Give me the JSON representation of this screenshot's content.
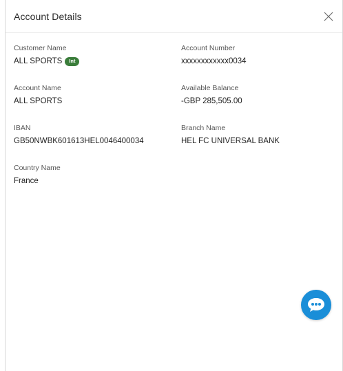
{
  "dialog": {
    "title": "Account Details",
    "close_icon": "close-icon"
  },
  "fields": {
    "customer_name": {
      "label": "Customer Name",
      "value": "ALL SPORTS",
      "badge": "Int"
    },
    "account_number": {
      "label": "Account Number",
      "value": "xxxxxxxxxxxx0034"
    },
    "account_name": {
      "label": "Account Name",
      "value": "ALL SPORTS"
    },
    "available_balance": {
      "label": "Available Balance",
      "value": "-GBP 285,505.00"
    },
    "iban": {
      "label": "IBAN",
      "value": "GB50NWBK601613HEL0046400034"
    },
    "branch_name": {
      "label": "Branch Name",
      "value": "HEL FC UNIVERSAL BANK"
    },
    "country_name": {
      "label": "Country Name",
      "value": "France"
    }
  },
  "chat": {
    "icon": "chat-bubble-icon",
    "color": "#1a8ed8"
  },
  "colors": {
    "badge": "#3a7d3a",
    "chat": "#1a8ed8"
  }
}
